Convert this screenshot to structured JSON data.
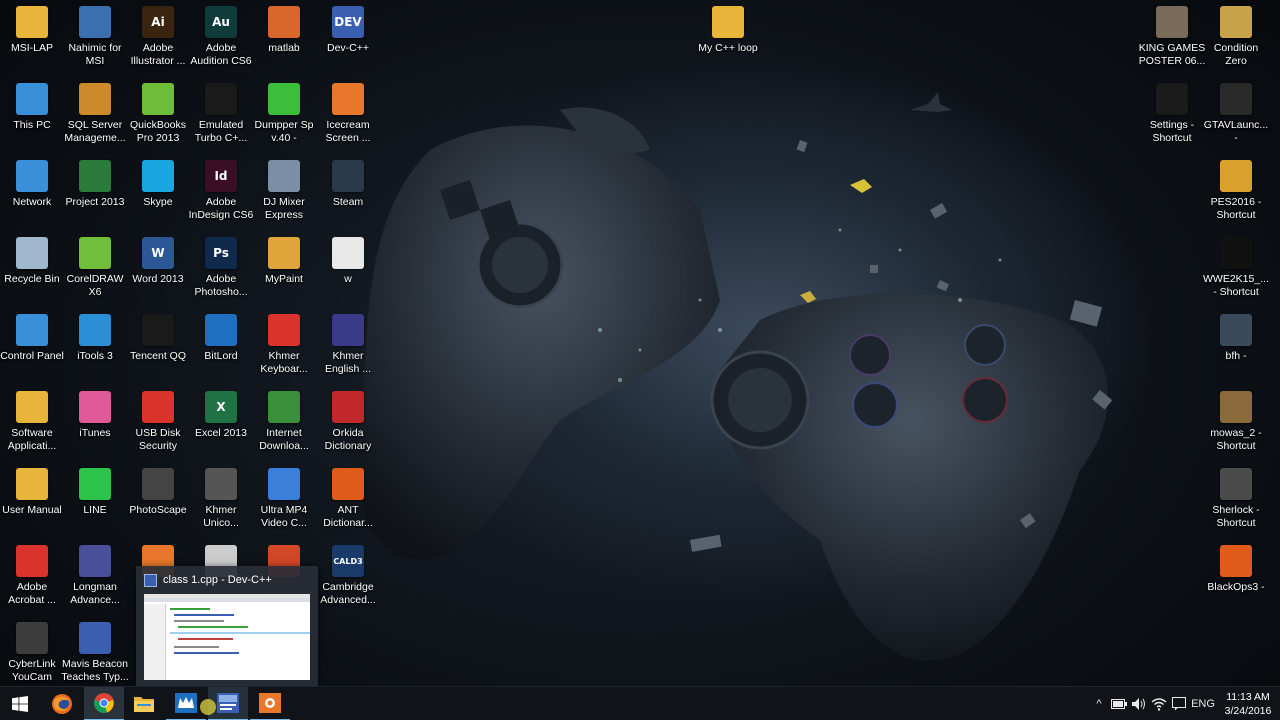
{
  "desktop": {
    "columns": [
      [
        {
          "label": "MSI-LAP",
          "icon": "folder-icon",
          "color": "#e8b43a"
        },
        {
          "label": "This PC",
          "icon": "computer-icon",
          "color": "#3a8fd9"
        },
        {
          "label": "Network",
          "icon": "network-icon",
          "color": "#3a8fd9"
        },
        {
          "label": "Recycle Bin",
          "icon": "recycle-bin-icon",
          "color": "#9fb7cc"
        },
        {
          "label": "Control Panel",
          "icon": "control-panel-icon",
          "color": "#3a8fd9"
        },
        {
          "label": "Software\nApplicati...",
          "icon": "folder-icon",
          "color": "#e8b43a"
        },
        {
          "label": "User Manual",
          "icon": "folder-icon",
          "color": "#e8b43a"
        },
        {
          "label": "Adobe\nAcrobat ...",
          "icon": "acrobat-icon",
          "color": "#d9332b"
        },
        {
          "label": "CyberLink\nYouCam",
          "icon": "webcam-icon",
          "color": "#3c3c3c"
        }
      ],
      [
        {
          "label": "Nahimic for\nMSI",
          "icon": "nahimic-icon",
          "color": "#3a6fb0"
        },
        {
          "label": "SQL Server\nManageme...",
          "icon": "sql-server-icon",
          "color": "#cc8a2a"
        },
        {
          "label": "Project 2013",
          "icon": "project-icon",
          "color": "#2b7a3b"
        },
        {
          "label": "CorelDRAW\nX6",
          "icon": "coreldraw-icon",
          "color": "#6fbf3a"
        },
        {
          "label": "iTools 3",
          "icon": "itools-icon",
          "color": "#2b8fd6"
        },
        {
          "label": "iTunes",
          "icon": "itunes-icon",
          "color": "#e05a9a"
        },
        {
          "label": "LINE",
          "icon": "line-icon",
          "color": "#2dc24a"
        },
        {
          "label": "Longman\nAdvance...",
          "icon": "longman-icon",
          "color": "#4a4f9a"
        },
        {
          "label": "Mavis Beacon\nTeaches Typ...",
          "icon": "mavis-beacon-icon",
          "color": "#3a5fb0"
        }
      ],
      [
        {
          "label": "Adobe\nIllustrator ...",
          "icon": "illustrator-icon",
          "color": "#3a2410",
          "text": "Ai"
        },
        {
          "label": "QuickBooks\nPro 2013",
          "icon": "quickbooks-icon",
          "color": "#6dbd3b"
        },
        {
          "label": "Skype",
          "icon": "skype-icon",
          "color": "#19a6e0"
        },
        {
          "label": "Word 2013",
          "icon": "word-icon",
          "color": "#2b5797",
          "text": "W"
        },
        {
          "label": "Tencent QQ",
          "icon": "qq-icon",
          "color": "#1a1a1a"
        },
        {
          "label": "USB Disk\nSecurity",
          "icon": "usb-security-icon",
          "color": "#d9332b"
        },
        {
          "label": "PhotoScape",
          "icon": "photoscape-icon",
          "color": "#444444"
        }
      ],
      [
        {
          "label": "Adobe\nAudition CS6",
          "icon": "audition-icon",
          "color": "#0f3b3a",
          "text": "Au"
        },
        {
          "label": "Emulated\nTurbo C+...",
          "icon": "turbo-c-icon",
          "color": "#1a1a1a"
        },
        {
          "label": "Adobe\nInDesign CS6",
          "icon": "indesign-icon",
          "color": "#3a0f26",
          "text": "Id"
        },
        {
          "label": "Adobe\nPhotosho...",
          "icon": "photoshop-icon",
          "color": "#0f2a4a",
          "text": "Ps"
        },
        {
          "label": "BitLord",
          "icon": "bitlord-icon",
          "color": "#1f6fc0"
        },
        {
          "label": "Excel 2013",
          "icon": "excel-icon",
          "color": "#1f7244",
          "text": "X"
        },
        {
          "label": "Khmer\nUnico...",
          "icon": "keyboard-icon",
          "color": "#555555"
        }
      ],
      [
        {
          "label": "matlab",
          "icon": "matlab-icon",
          "color": "#d9662b"
        },
        {
          "label": "Dumpper Sp\nv.40 -",
          "icon": "wifi-icon",
          "color": "#3bbf3a"
        },
        {
          "label": "DJ Mixer\nExpress",
          "icon": "dj-mixer-icon",
          "color": "#7a8fa6"
        },
        {
          "label": "MyPaint",
          "icon": "mypaint-icon",
          "color": "#e0a53a"
        },
        {
          "label": "Khmer\nKeyboar...",
          "icon": "pdf-icon",
          "color": "#d9332b"
        },
        {
          "label": "Internet\nDownloa...",
          "icon": "idm-icon",
          "color": "#3a8f3a"
        },
        {
          "label": "Ultra MP4\nVideo C...",
          "icon": "video-converter-icon",
          "color": "#3a7fd9"
        }
      ],
      [
        {
          "label": "Dev-C++",
          "icon": "dev-cpp-icon",
          "color": "#3a5fb0",
          "text": "DEV"
        },
        {
          "label": "Icecream\nScreen ...",
          "icon": "icecream-icon",
          "color": "#e8772b"
        },
        {
          "label": "Steam",
          "icon": "steam-icon",
          "color": "#2a3a4a"
        },
        {
          "label": "w",
          "icon": "document-icon",
          "color": "#e8e8e8"
        },
        {
          "label": "Khmer\nEnglish ...",
          "icon": "dictionary-icon",
          "color": "#3a3a8a"
        },
        {
          "label": "Orkida\nDictionary",
          "icon": "orkida-icon",
          "color": "#c0282b"
        },
        {
          "label": "ANT\nDictionar...",
          "icon": "ant-dictionary-icon",
          "color": "#e05a1a"
        },
        {
          "label": "Cambridge\nAdvanced...",
          "icon": "cambridge-icon",
          "color": "#1a3a6a",
          "text": "CALD3"
        }
      ]
    ],
    "middle_icon": {
      "label": "My C++ loop",
      "icon": "folder-icon",
      "color": "#e8b43a"
    },
    "right_columns": [
      [
        {
          "label": "KING GAMES\nPOSTER 06...",
          "icon": "image-icon",
          "color": "#7a6a5a"
        },
        {
          "label": "Settings -\nShortcut",
          "icon": "pes-settings-icon",
          "color": "#1a1a1a"
        }
      ],
      [
        {
          "label": "Condition\nZero",
          "icon": "counter-strike-icon",
          "color": "#c8a24a"
        },
        {
          "label": "GTAVLaunc...\n-",
          "icon": "gta-icon",
          "color": "#2a2a2a"
        },
        {
          "label": "PES2016 -\nShortcut",
          "icon": "pes-icon",
          "color": "#d9a02b"
        },
        {
          "label": "WWE2K15_...\n- Shortcut",
          "icon": "wwe-icon",
          "color": "#111111"
        },
        {
          "label": "bfh -",
          "icon": "bfh-icon",
          "color": "#3a4a5a"
        },
        {
          "label": "mowas_2 -\nShortcut",
          "icon": "mowas-icon",
          "color": "#8a6a3a"
        },
        {
          "label": "Sherlock -\nShortcut",
          "icon": "sherlock-icon",
          "color": "#4a4a4a"
        },
        {
          "label": "BlackOps3 -",
          "icon": "blackops-icon",
          "color": "#e05a1a"
        }
      ]
    ],
    "partial_icons": [
      {
        "icon": "vlc-icon",
        "color": "#e8772b"
      },
      {
        "icon": "app-icon",
        "color": "#cccccc"
      },
      {
        "icon": "powerpoint-icon",
        "color": "#d24726"
      }
    ]
  },
  "preview": {
    "title": "class 1.cpp - Dev-C++",
    "icon": "dev-cpp-icon"
  },
  "taskbar": {
    "apps": [
      {
        "name": "start-button",
        "icon": "windows-icon"
      },
      {
        "name": "firefox-taskbar-button",
        "icon": "firefox-icon"
      },
      {
        "name": "chrome-taskbar-button",
        "icon": "chrome-icon"
      },
      {
        "name": "file-explorer-taskbar-button",
        "icon": "folder-icon"
      },
      {
        "name": "bitlord-taskbar-button",
        "icon": "bitlord-icon"
      },
      {
        "name": "dev-cpp-taskbar-button",
        "icon": "dev-cpp-icon"
      },
      {
        "name": "icecream-taskbar-button",
        "icon": "icecream-icon"
      }
    ],
    "tray": {
      "language": "ENG",
      "time": "11:13 AM",
      "date": "3/24/2016"
    }
  }
}
